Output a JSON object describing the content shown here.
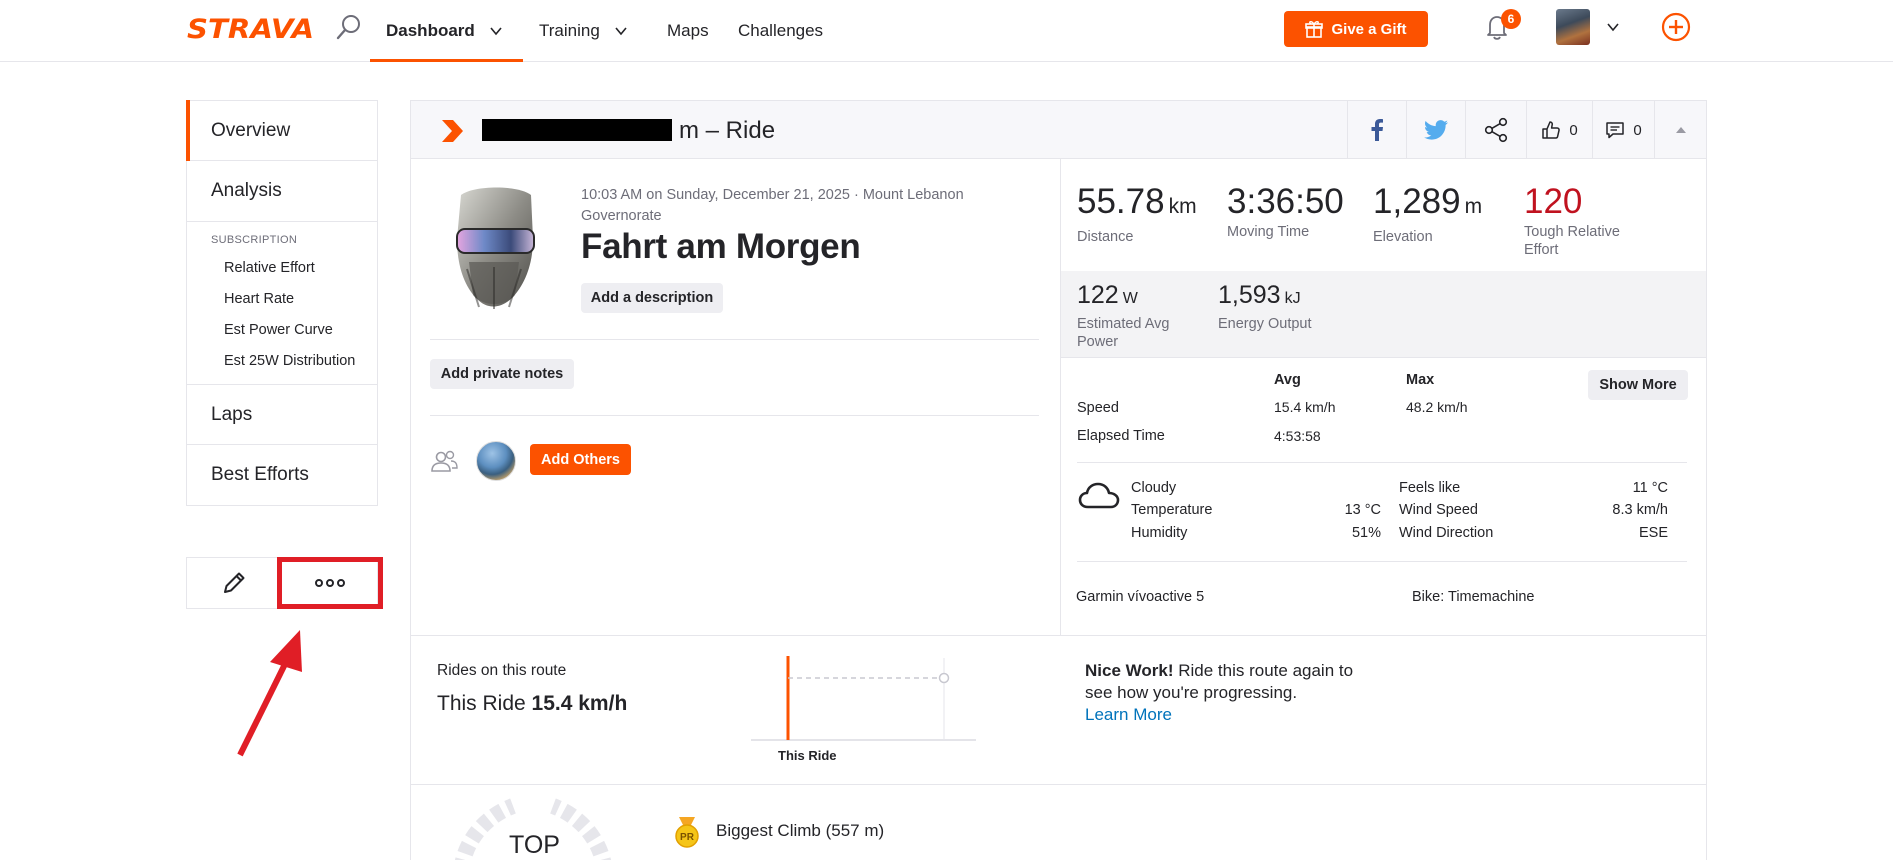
{
  "nav": {
    "logo": "STRAVA",
    "items": [
      {
        "label": "Dashboard"
      },
      {
        "label": "Training"
      },
      {
        "label": "Maps"
      },
      {
        "label": "Challenges"
      }
    ],
    "gift_label": "Give a Gift",
    "notification_count": "6",
    "accent_color": "#fc5200"
  },
  "sidebar": {
    "tabs": [
      {
        "label": "Overview",
        "active": true
      },
      {
        "label": "Analysis"
      }
    ],
    "subscription_heading": "SUBSCRIPTION",
    "sub_items": [
      {
        "label": "Relative Effort"
      },
      {
        "label": "Heart Rate"
      },
      {
        "label": "Est Power Curve"
      },
      {
        "label": "Est 25W Distribution"
      }
    ],
    "bottom_tabs": [
      {
        "label": "Laps"
      },
      {
        "label": "Best Efforts"
      }
    ],
    "actions": {
      "edit_icon": "pencil-icon",
      "more_icon": "more-options-icon"
    }
  },
  "activity": {
    "title_suffix": "m – Ride",
    "meta": "10:03 AM on Sunday, December 21, 2025 · Mount Lebanon Governorate",
    "name": "Fahrt am Morgen",
    "add_description": "Add a description",
    "add_private_notes": "Add private notes",
    "add_others": "Add Others",
    "kudos_count": "0",
    "comment_count": "0"
  },
  "stats": {
    "distance": {
      "value": "55.78",
      "unit": "km",
      "label": "Distance"
    },
    "moving_time": {
      "value": "3:36:50",
      "label": "Moving Time"
    },
    "elevation": {
      "value": "1,289",
      "unit": "m",
      "label": "Elevation"
    },
    "relative_effort": {
      "value": "120",
      "label": "Tough Relative Effort"
    },
    "avg_power": {
      "value": "122",
      "unit": "W",
      "label": "Estimated Avg Power"
    },
    "energy": {
      "value": "1,593",
      "unit": "kJ",
      "label": "Energy Output"
    }
  },
  "speed_table": {
    "col_avg": "Avg",
    "col_max": "Max",
    "speed_label": "Speed",
    "speed_avg": "15.4 km/h",
    "speed_max": "48.2 km/h",
    "elapsed_label": "Elapsed Time",
    "elapsed_value": "4:53:58",
    "show_more": "Show More"
  },
  "weather": {
    "condition": "Cloudy",
    "temperature_label": "Temperature",
    "temperature": "13 °C",
    "humidity_label": "Humidity",
    "humidity": "51%",
    "feels_like_label": "Feels like",
    "feels_like": "11 °C",
    "wind_speed_label": "Wind Speed",
    "wind_speed": "8.3 km/h",
    "wind_dir_label": "Wind Direction",
    "wind_dir": "ESE"
  },
  "equipment": {
    "device": "Garmin vívoactive 5",
    "bike": "Bike: Timemachine"
  },
  "route": {
    "heading": "Rides on this route",
    "this_ride_prefix": "This Ride",
    "this_ride_speed": "15.4 km/h",
    "chart_label": "This Ride",
    "nice_bold": "Nice Work!",
    "nice_text": "Ride this route again to see how you're progressing.",
    "learn_more": "Learn More"
  },
  "achievements": {
    "badge_label": "TOP",
    "pr_icon": "pr-medal-icon",
    "climb_text": "Biggest Climb  (557 m)"
  }
}
